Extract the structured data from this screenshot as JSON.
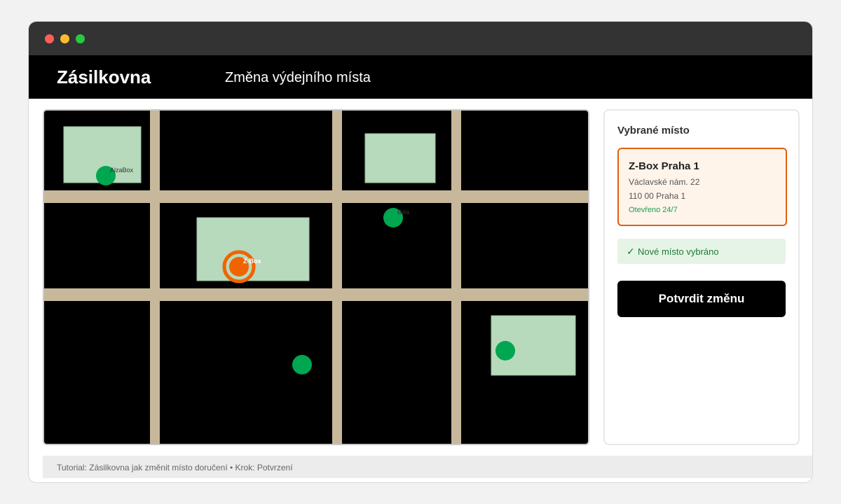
{
  "window": {
    "controls": [
      {
        "name": "close",
        "color": "#ff5f57"
      },
      {
        "name": "minimize",
        "color": "#febc2e"
      },
      {
        "name": "maximize",
        "color": "#28c840"
      }
    ]
  },
  "header": {
    "brand": "Zásilkovna",
    "title": "Změna výdejního místa"
  },
  "map": {
    "pins": [
      {
        "label": "AlzaBox",
        "selected": false,
        "color": "#00a650"
      },
      {
        "label": "Z-Box",
        "selected": true,
        "color": "#f06400"
      },
      {
        "label": "Billa",
        "selected": false,
        "color": "#00a650"
      },
      {
        "label": "",
        "selected": false,
        "color": "#00a650"
      },
      {
        "label": "",
        "selected": false,
        "color": "#00a650"
      }
    ],
    "colors": {
      "road": "#c7b89b",
      "block": "#000000",
      "park": "#b7d9bc"
    }
  },
  "panel": {
    "heading": "Vybrané místo",
    "place": {
      "name": "Z-Box Praha 1",
      "street": "Václavské nám. 22",
      "city": "110 00 Praha 1",
      "hours": "Otevřeno 24/7"
    },
    "success": {
      "icon": "check-icon",
      "message": "Nové místo vybráno"
    },
    "confirm_label": "Potvrdit změnu"
  },
  "footer": {
    "text": "Tutorial: Zásilkovna jak změnit místo doručení • Krok: Potvrzení"
  },
  "colors": {
    "accent": "#e06010",
    "success": "#1f7a35"
  }
}
